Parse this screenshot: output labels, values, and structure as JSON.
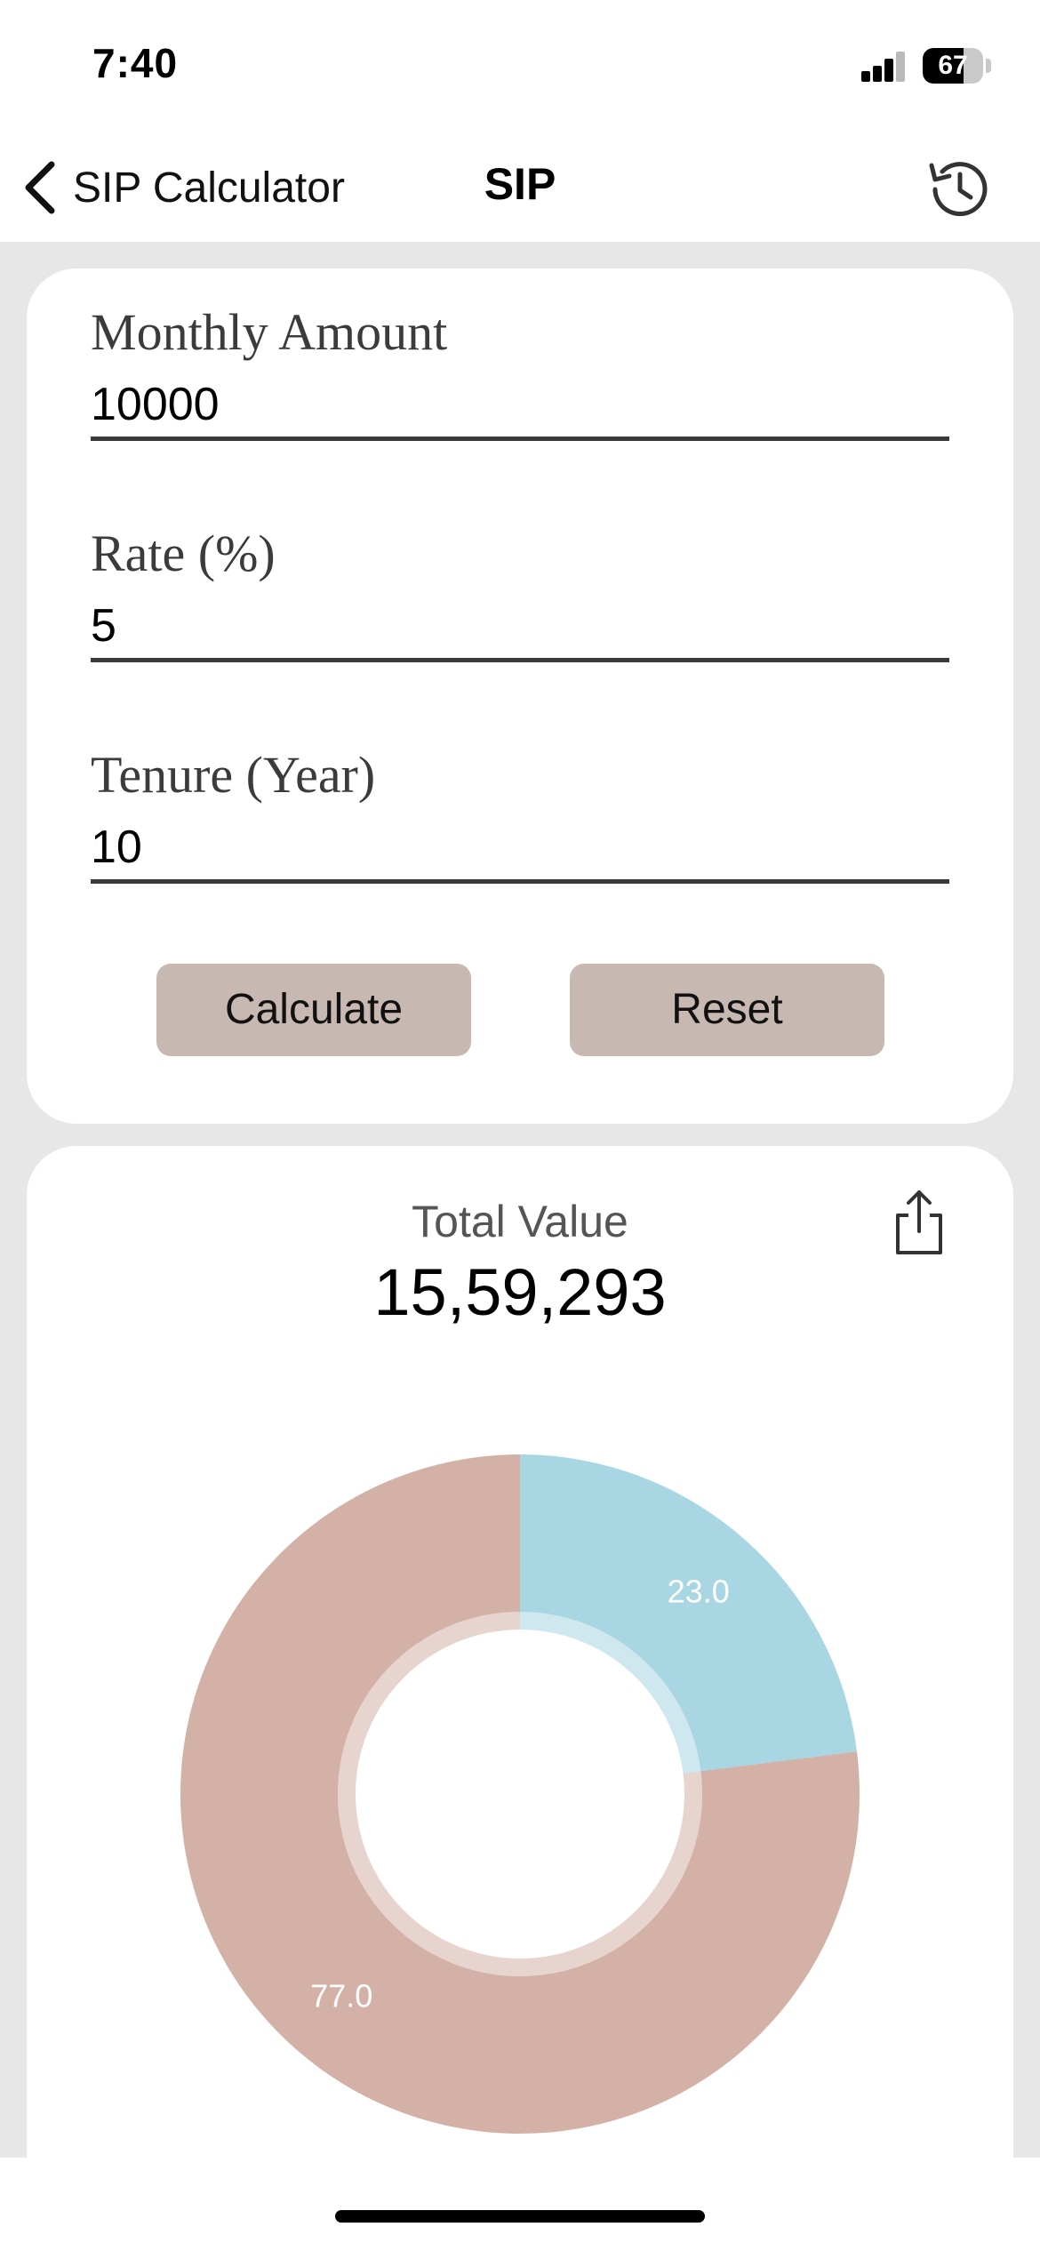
{
  "status_bar": {
    "time": "7:40",
    "battery_percent": "67",
    "signal_bars": 3,
    "signal_bars_total": 4
  },
  "nav": {
    "back_label": "SIP Calculator",
    "title": "SIP",
    "back_icon": "chevron-left-icon",
    "right_icon": "history-icon"
  },
  "form": {
    "monthly_amount": {
      "label": "Monthly Amount",
      "value": "10000"
    },
    "rate": {
      "label": "Rate (%)",
      "value": "5"
    },
    "tenure": {
      "label": "Tenure (Year)",
      "value": "10"
    },
    "calculate_label": "Calculate",
    "reset_label": "Reset"
  },
  "result": {
    "total_label": "Total Value",
    "total_value": "15,59,293",
    "share_icon": "share-icon"
  },
  "chart_data": {
    "type": "pie",
    "donut": true,
    "slices": [
      {
        "label": "23.0",
        "value": 23.0,
        "color": "#a8d6e3"
      },
      {
        "label": "77.0",
        "value": 77.0,
        "color": "#d4b1a6"
      }
    ]
  },
  "colors": {
    "background": "#e7e7e7",
    "card": "#ffffff",
    "button": "#c7b8b2",
    "slice_blue": "#a8d6e3",
    "slice_rose": "#d4b1a6"
  }
}
